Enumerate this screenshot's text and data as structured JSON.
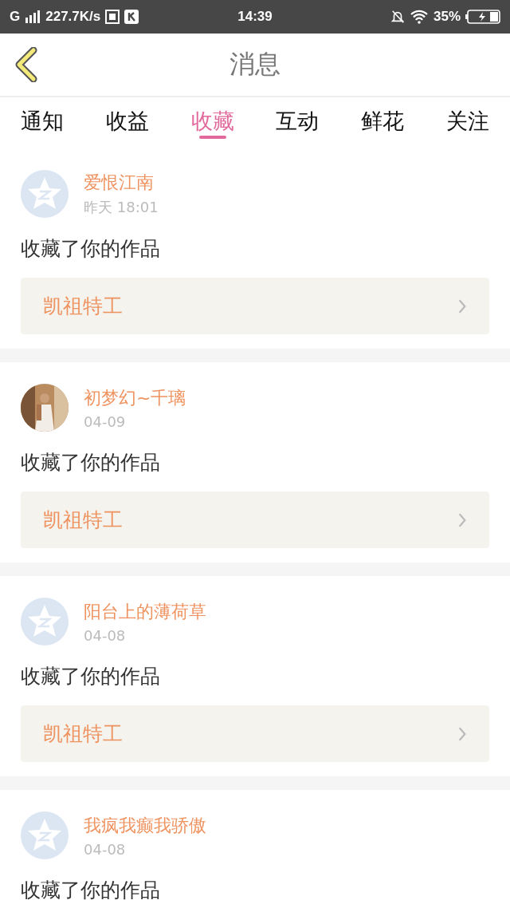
{
  "status_bar": {
    "network": "G",
    "speed": "227.7K/s",
    "time": "14:39",
    "battery": "35%"
  },
  "header": {
    "title": "消息"
  },
  "tabs": [
    {
      "label": "通知",
      "selected": false
    },
    {
      "label": "收益",
      "selected": false
    },
    {
      "label": "收藏",
      "selected": true
    },
    {
      "label": "互动",
      "selected": false
    },
    {
      "label": "鲜花",
      "selected": false
    },
    {
      "label": "关注",
      "selected": false
    }
  ],
  "messages": [
    {
      "avatar": {
        "kind": "default"
      },
      "name": "爱恨江南",
      "time": "昨天 18:01",
      "text": "收藏了你的作品",
      "work": "凯祖特工"
    },
    {
      "name": "初梦幻~千璃",
      "time": "04-09",
      "text": "收藏了你的作品",
      "work": "凯祖特工"
    },
    {
      "avatar": {
        "kind": "default"
      },
      "name": "阳台上的薄荷草",
      "time": "04-08",
      "text": "收藏了你的作品",
      "work": "凯祖特工"
    },
    {
      "avatar": {
        "kind": "default"
      },
      "name": "我疯我癫我骄傲",
      "time": "04-08",
      "text": "收藏了你的作品"
    }
  ]
}
